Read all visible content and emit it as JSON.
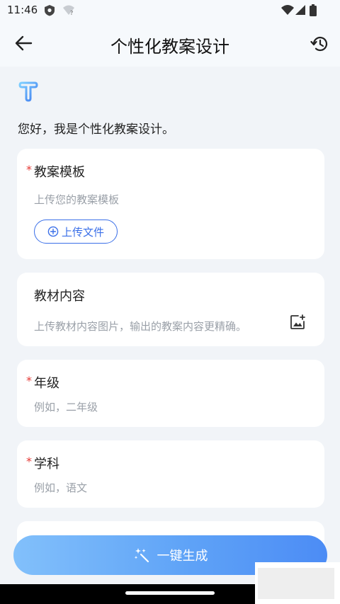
{
  "status": {
    "time": "11:46"
  },
  "header": {
    "title": "个性化教案设计"
  },
  "greeting": "您好，我是个性化教案设计。",
  "template_card": {
    "required_mark": "*",
    "label": "教案模板",
    "placeholder": "上传您的教案模板",
    "upload_label": "上传文件"
  },
  "material_card": {
    "label": "教材内容",
    "placeholder": "上传教材内容图片，输出的教案内容更精确。"
  },
  "grade_card": {
    "required_mark": "*",
    "label": "年级",
    "placeholder": "例如，二年级"
  },
  "subject_card": {
    "required_mark": "*",
    "label": "学科",
    "placeholder": "例如，语文"
  },
  "generate_button": {
    "label": "一键生成"
  },
  "colors": {
    "accent": "#3a6fe8",
    "required": "#e53935",
    "button_start": "#82c0fb",
    "button_end": "#4c8cf5"
  }
}
